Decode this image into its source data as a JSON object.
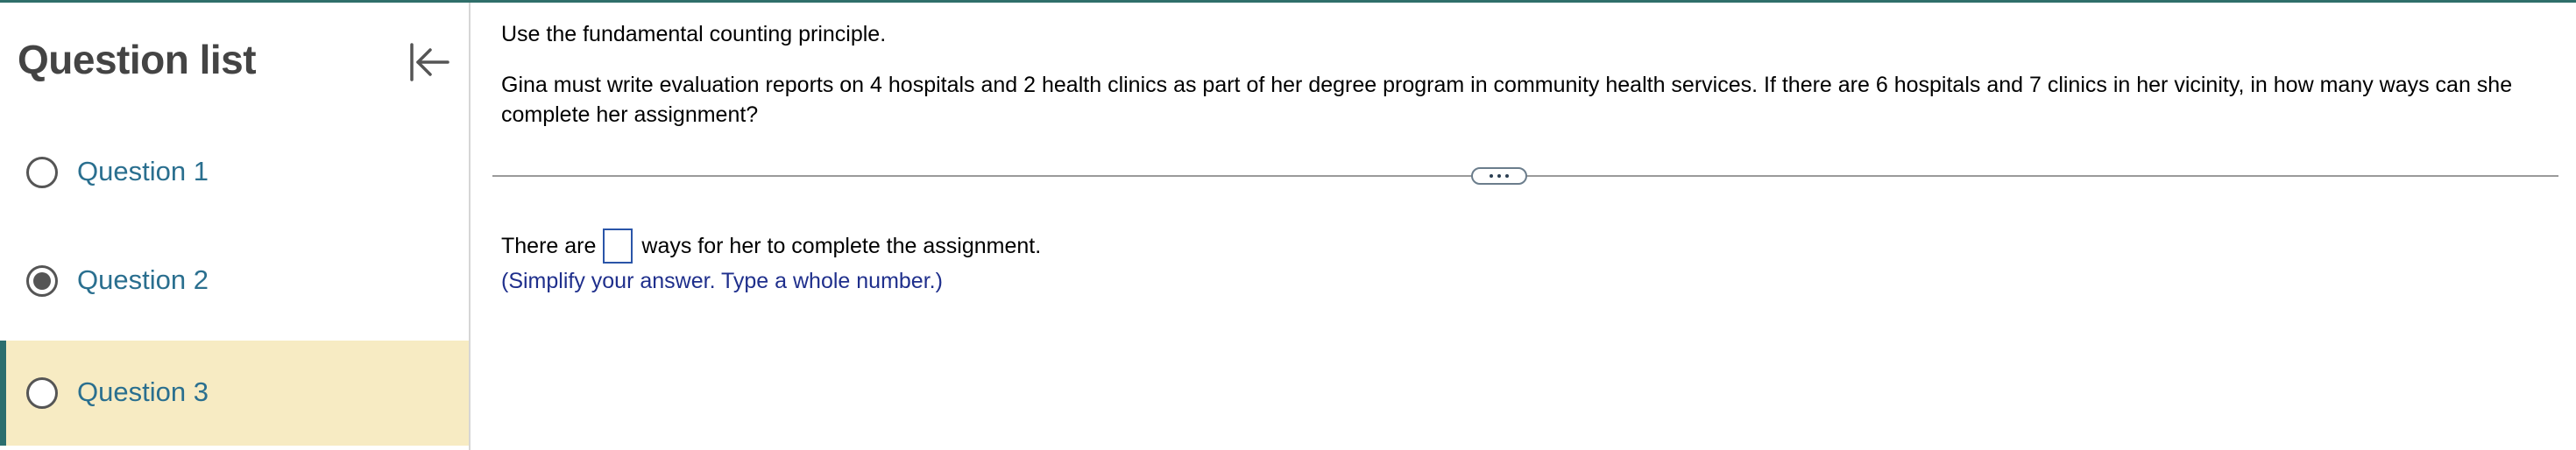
{
  "sidebar": {
    "title": "Question list",
    "collapse_icon": "collapse-left-icon",
    "items": [
      {
        "label": "Question 1",
        "state": "unanswered"
      },
      {
        "label": "Question 2",
        "state": "answered"
      },
      {
        "label": "Question 3",
        "state": "current"
      }
    ]
  },
  "question": {
    "instruction": "Use the fundamental counting principle.",
    "problem": "Gina must write evaluation reports on 4 hospitals and 2 health clinics as part of her degree program in community health services. If there are 6 hospitals and 7 clinics in her vicinity, in how many ways can she complete her assignment?",
    "answer_prefix": "There are",
    "answer_value": "",
    "answer_suffix": "ways for her to complete the assignment.",
    "hint": "(Simplify your answer. Type a whole number.)"
  },
  "colors": {
    "accent_bar": "#2b6e6e",
    "current_item_bg": "#f7ebc3",
    "link_text": "#2a6f8f",
    "hint_text": "#1f2f8c",
    "input_border": "#2a55a8"
  }
}
